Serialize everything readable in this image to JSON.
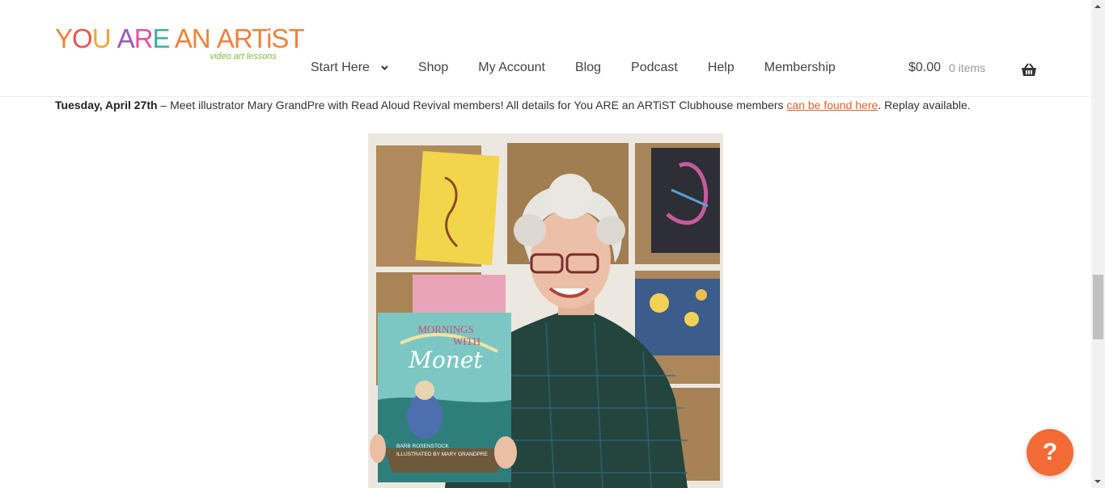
{
  "logo": {
    "wordmark": [
      {
        "text": "Y",
        "color": "#f0823c"
      },
      {
        "text": "O",
        "color": "#e9554e"
      },
      {
        "text": "U ",
        "color": "#f7a43c"
      },
      {
        "text": "A",
        "color": "#9b59b6"
      },
      {
        "text": "R",
        "color": "#e8539b"
      },
      {
        "text": "E",
        "color": "#3ab0a0"
      },
      {
        "text": " AN ",
        "color": "#f0823c"
      },
      {
        "text": "ARTiST",
        "color": "#f0823c"
      }
    ],
    "tagline": "video art lessons"
  },
  "nav": {
    "items": [
      {
        "label": "Start Here",
        "has_dropdown": true
      },
      {
        "label": "Shop"
      },
      {
        "label": "My Account"
      },
      {
        "label": "Blog"
      },
      {
        "label": "Podcast"
      },
      {
        "label": "Help"
      },
      {
        "label": "Membership"
      }
    ],
    "dropdown_icon": "chevron-down-icon"
  },
  "cart": {
    "amount": "$0.00",
    "count": "0 items",
    "icon": "basket-icon"
  },
  "notice": {
    "date": "Tuesday, April 27th",
    "text_before": " – Meet illustrator Mary GrandPre with Read Aloud Revival members! All details for You ARE an ARTiST Clubhouse members ",
    "link_text": "can be found here",
    "text_after": ". Replay available."
  },
  "photo": {
    "book_title_line1": "MORNINGS",
    "book_title_line2": "WITH",
    "book_title_line3": "Monet",
    "book_author": "BARB ROSENSTOCK",
    "book_illustrator": "ILLUSTRATED BY MARY GRANDPRE"
  },
  "help_button": {
    "label": "?",
    "color": "#f26b35"
  },
  "colors": {
    "link": "#e8622d",
    "accent": "#f26b35"
  }
}
